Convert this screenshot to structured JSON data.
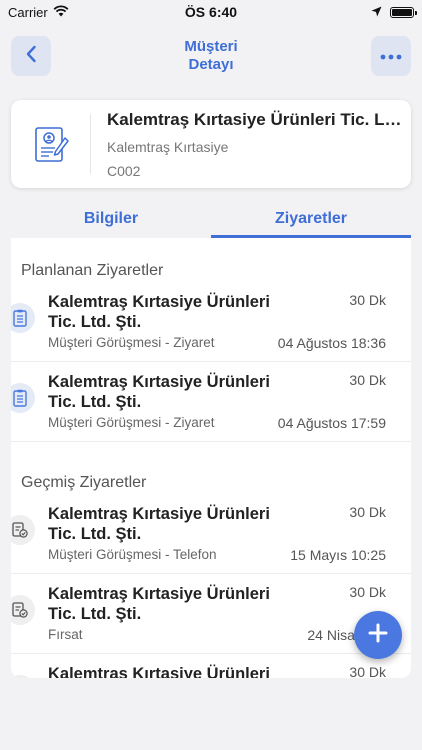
{
  "status_bar": {
    "carrier": "Carrier",
    "time": "ÖS 6:40"
  },
  "header": {
    "title": "Müşteri\nDetayı"
  },
  "customer": {
    "name": "Kalemtraş Kırtasiye Ürünleri Tic. Ltd. Şti.",
    "short_name": "Kalemtraş Kırtasiye",
    "code": "C002"
  },
  "tabs": [
    {
      "label": "Bilgiler",
      "active": false
    },
    {
      "label": "Ziyaretler",
      "active": true
    }
  ],
  "planned": {
    "title": "Planlanan Ziyaretler",
    "items": [
      {
        "title": "Kalemtraş Kırtasiye Ürünleri Tic. Ltd. Şti.",
        "duration": "30 Dk",
        "type": "Müşteri Görüşmesi - Ziyaret",
        "date": "04 Ağustos 18:36"
      },
      {
        "title": "Kalemtraş Kırtasiye Ürünleri Tic. Ltd. Şti.",
        "duration": "30 Dk",
        "type": "Müşteri Görüşmesi - Ziyaret",
        "date": "04 Ağustos 17:59"
      }
    ]
  },
  "past": {
    "title": "Geçmiş Ziyaretler",
    "items": [
      {
        "title": "Kalemtraş Kırtasiye Ürünleri Tic. Ltd. Şti.",
        "duration": "30 Dk",
        "type": "Müşteri Görüşmesi - Telefon",
        "date": "15 Mayıs 10:25"
      },
      {
        "title": "Kalemtraş Kırtasiye Ürünleri Tic. Ltd. Şti.",
        "duration": "30 Dk",
        "type": "Fırsat",
        "date": "24 Nisan 10:"
      },
      {
        "title": "Kalemtraş Kırtasiye Ürünleri Tic. Ltd. Şti.",
        "duration": "30 Dk",
        "type": "",
        "date": ""
      }
    ]
  },
  "colors": {
    "accent": "#3e6ed6",
    "fab": "#4a78e0"
  },
  "icons": {
    "back": "chevron-left-icon",
    "more": "more-icon",
    "add": "plus-icon"
  }
}
